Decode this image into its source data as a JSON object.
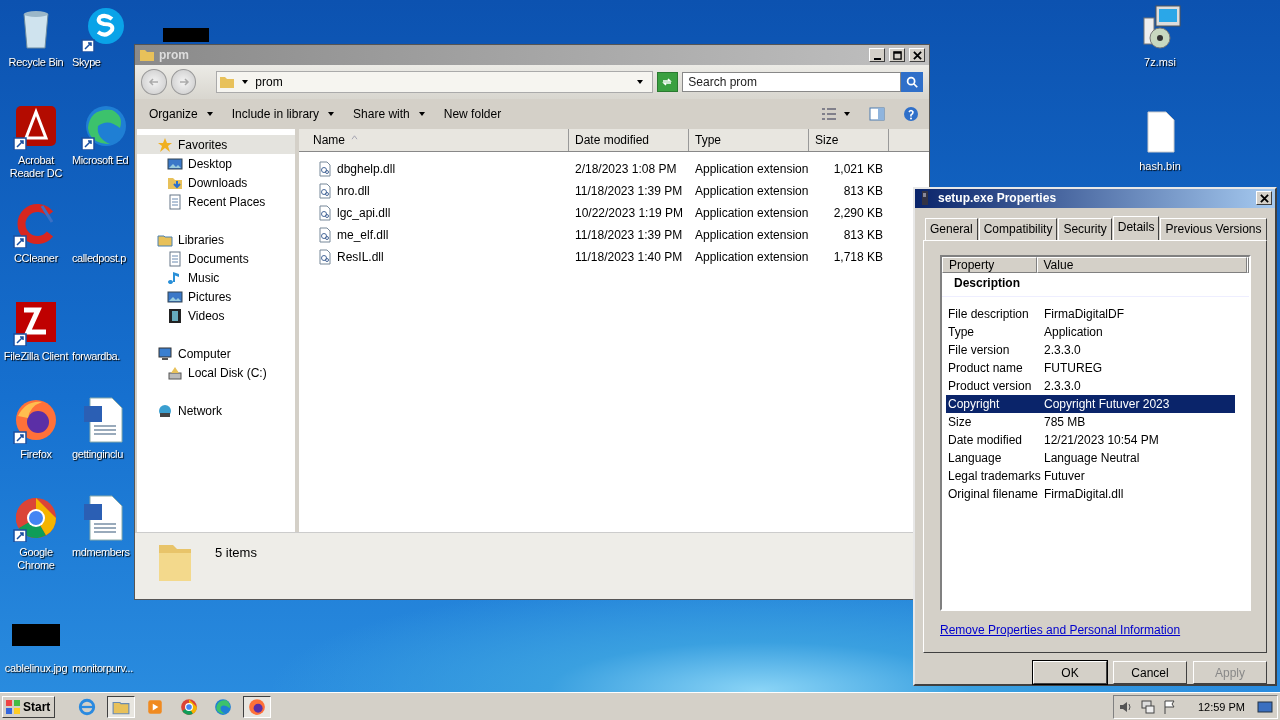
{
  "desktop": {
    "column_1": [
      {
        "label": "Recycle Bin",
        "kind": "recycle-bin",
        "shortcut": false
      },
      {
        "label": "Acrobat Reader DC",
        "kind": "acrobat",
        "shortcut": true
      },
      {
        "label": "CCleaner",
        "kind": "ccleaner",
        "shortcut": true
      },
      {
        "label": "FileZilla Client",
        "kind": "filezilla",
        "shortcut": true
      },
      {
        "label": "Firefox",
        "kind": "firefox",
        "shortcut": true
      },
      {
        "label": "Google Chrome",
        "kind": "chrome",
        "shortcut": true
      },
      {
        "label": "cablelinux.jpg",
        "kind": "redacted",
        "shortcut": false
      }
    ],
    "column_2": [
      {
        "label": "Skype",
        "kind": "skype",
        "shortcut": true
      },
      {
        "label": "Microsoft Ed",
        "kind": "edge",
        "shortcut": true
      },
      {
        "label": "calledpost.p",
        "kind": "none"
      },
      {
        "label": "forwardba.",
        "kind": "none"
      },
      {
        "label": "gettinginclu",
        "kind": "word",
        "shortcut": false
      },
      {
        "label": "mdmembers",
        "kind": "word",
        "shortcut": false
      },
      {
        "label": "monitorpurv...",
        "kind": "none"
      }
    ],
    "column_3": [
      {
        "label": "7z.msi",
        "kind": "msi",
        "shortcut": false
      },
      {
        "label": "hash.bin",
        "kind": "file",
        "shortcut": false
      }
    ]
  },
  "explorer": {
    "title": "prom",
    "address": "prom",
    "search": {
      "placeholder": "Search prom"
    },
    "toolbar": [
      {
        "label": "Organize",
        "dropdown": true
      },
      {
        "label": "Include in library",
        "dropdown": true
      },
      {
        "label": "Share with",
        "dropdown": true
      },
      {
        "label": "New folder",
        "dropdown": false
      }
    ],
    "navigation": [
      {
        "label": "Favorites",
        "kind": "star",
        "selected": true,
        "children": [
          {
            "label": "Desktop",
            "kind": "desktop",
            "selected": false
          },
          {
            "label": "Downloads",
            "kind": "downloads",
            "selected": false
          },
          {
            "label": "Recent Places",
            "kind": "recent",
            "selected": false
          }
        ]
      },
      {
        "label": "Libraries",
        "kind": "libraries",
        "selected": false,
        "children": [
          {
            "label": "Documents",
            "kind": "documents",
            "selected": false
          },
          {
            "label": "Music",
            "kind": "music",
            "selected": false
          },
          {
            "label": "Pictures",
            "kind": "pictures",
            "selected": false
          },
          {
            "label": "Videos",
            "kind": "videos",
            "selected": false
          }
        ]
      },
      {
        "label": "Computer",
        "kind": "computer",
        "selected": false,
        "children": [
          {
            "label": "Local Disk (C:)",
            "kind": "disk",
            "selected": false
          }
        ]
      },
      {
        "label": "Network",
        "kind": "network",
        "selected": false
      }
    ],
    "columns": [
      {
        "label": "Name",
        "sorted": true
      },
      {
        "label": "Date modified",
        "sorted": false
      },
      {
        "label": "Type",
        "sorted": false
      },
      {
        "label": "Size",
        "sorted": false
      }
    ],
    "rows": [
      {
        "name": "dbghelp.dll",
        "date": "2/18/2023 1:08 PM",
        "type": "Application extension",
        "size": "1,021 KB"
      },
      {
        "name": "hro.dll",
        "date": "11/18/2023 1:39 PM",
        "type": "Application extension",
        "size": "813 KB"
      },
      {
        "name": "lgc_api.dll",
        "date": "10/22/2023 1:19 PM",
        "type": "Application extension",
        "size": "2,290 KB"
      },
      {
        "name": "me_elf.dll",
        "date": "11/18/2023 1:39 PM",
        "type": "Application extension",
        "size": "813 KB"
      },
      {
        "name": "ResIL.dll",
        "date": "11/18/2023 1:40 PM",
        "type": "Application extension",
        "size": "1,718 KB"
      }
    ],
    "status": "5 items"
  },
  "properties": {
    "title": "setup.exe Properties",
    "tabs": [
      {
        "label": "General",
        "selected": false
      },
      {
        "label": "Compatibility",
        "selected": false
      },
      {
        "label": "Security",
        "selected": false
      },
      {
        "label": "Details",
        "selected": true
      },
      {
        "label": "Previous Versions",
        "selected": false
      }
    ],
    "columns": [
      "Property",
      "Value"
    ],
    "group": "Description",
    "rows": [
      {
        "property": "File description",
        "value": "FirmaDigitalDF",
        "selected": false
      },
      {
        "property": "Type",
        "value": "Application",
        "selected": false
      },
      {
        "property": "File version",
        "value": "2.3.3.0",
        "selected": false
      },
      {
        "property": "Product name",
        "value": "FUTUREG",
        "selected": false
      },
      {
        "property": "Product version",
        "value": "2.3.3.0",
        "selected": false
      },
      {
        "property": "Copyright",
        "value": "Copyright Futuver 2023",
        "selected": true
      },
      {
        "property": "Size",
        "value": "785 MB",
        "selected": false
      },
      {
        "property": "Date modified",
        "value": "12/21/2023 10:54 PM",
        "selected": false
      },
      {
        "property": "Language",
        "value": "Language Neutral",
        "selected": false
      },
      {
        "property": "Legal trademarks",
        "value": "Futuver",
        "selected": false
      },
      {
        "property": "Original filename",
        "value": "FirmaDigital.dll",
        "selected": false
      }
    ],
    "link": "Remove Properties and Personal Information",
    "buttons": [
      {
        "label": "OK",
        "default": true,
        "disabled": false
      },
      {
        "label": "Cancel",
        "default": false,
        "disabled": false
      },
      {
        "label": "Apply",
        "default": false,
        "disabled": true
      }
    ]
  },
  "taskbar": {
    "start": "Start",
    "apps": [
      {
        "kind": "ie",
        "active": false
      },
      {
        "kind": "explorer",
        "active": true
      },
      {
        "kind": "media",
        "active": false
      },
      {
        "kind": "chrome",
        "active": false
      },
      {
        "kind": "edge",
        "active": false
      },
      {
        "kind": "firefox",
        "active": true
      }
    ],
    "clock": "12:59 PM"
  }
}
